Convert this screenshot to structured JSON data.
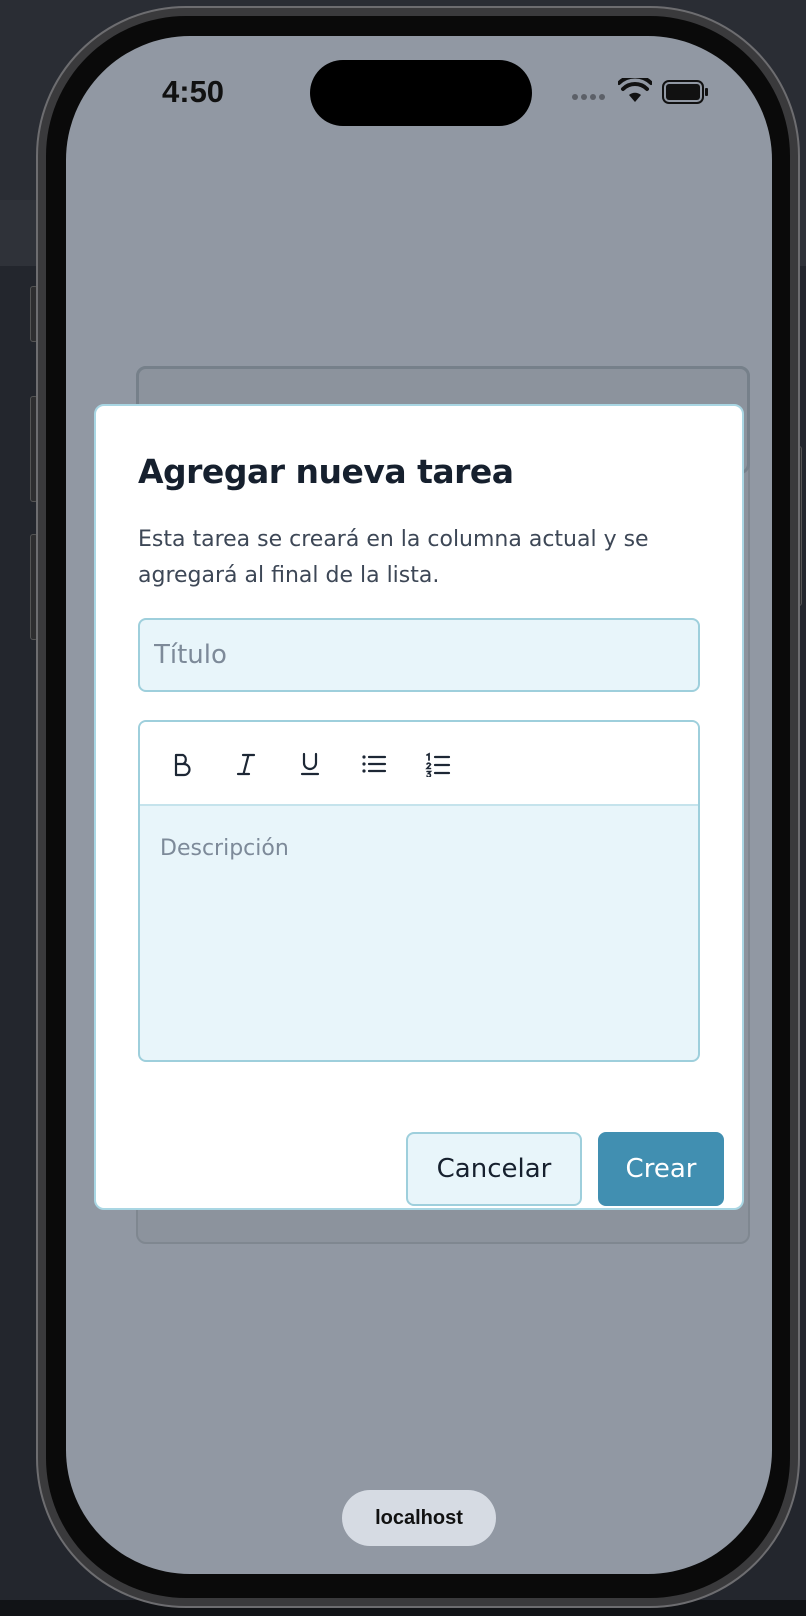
{
  "status_bar": {
    "time": "4:50",
    "wifi_icon": "wifi-icon",
    "battery_icon": "battery-icon"
  },
  "modal": {
    "title": "Agregar nueva tarea",
    "description": "Esta tarea se creará en la columna actual y se agregará al final de la lista.",
    "title_input": {
      "value": "",
      "placeholder": "Título"
    },
    "editor": {
      "toolbar": [
        {
          "name": "bold",
          "icon": "bold-icon"
        },
        {
          "name": "italic",
          "icon": "italic-icon"
        },
        {
          "name": "underline",
          "icon": "underline-icon"
        },
        {
          "name": "bullet-list",
          "icon": "bullet-list-icon"
        },
        {
          "name": "numbered-list",
          "icon": "numbered-list-icon"
        }
      ],
      "placeholder": "Descripción"
    },
    "cancel_label": "Cancelar",
    "create_label": "Crear"
  },
  "browser": {
    "url": "localhost"
  },
  "colors": {
    "accent": "#418fb1",
    "input_bg": "#e8f5fa",
    "input_border": "#9ecfdc",
    "overlay": "#9198a3"
  }
}
